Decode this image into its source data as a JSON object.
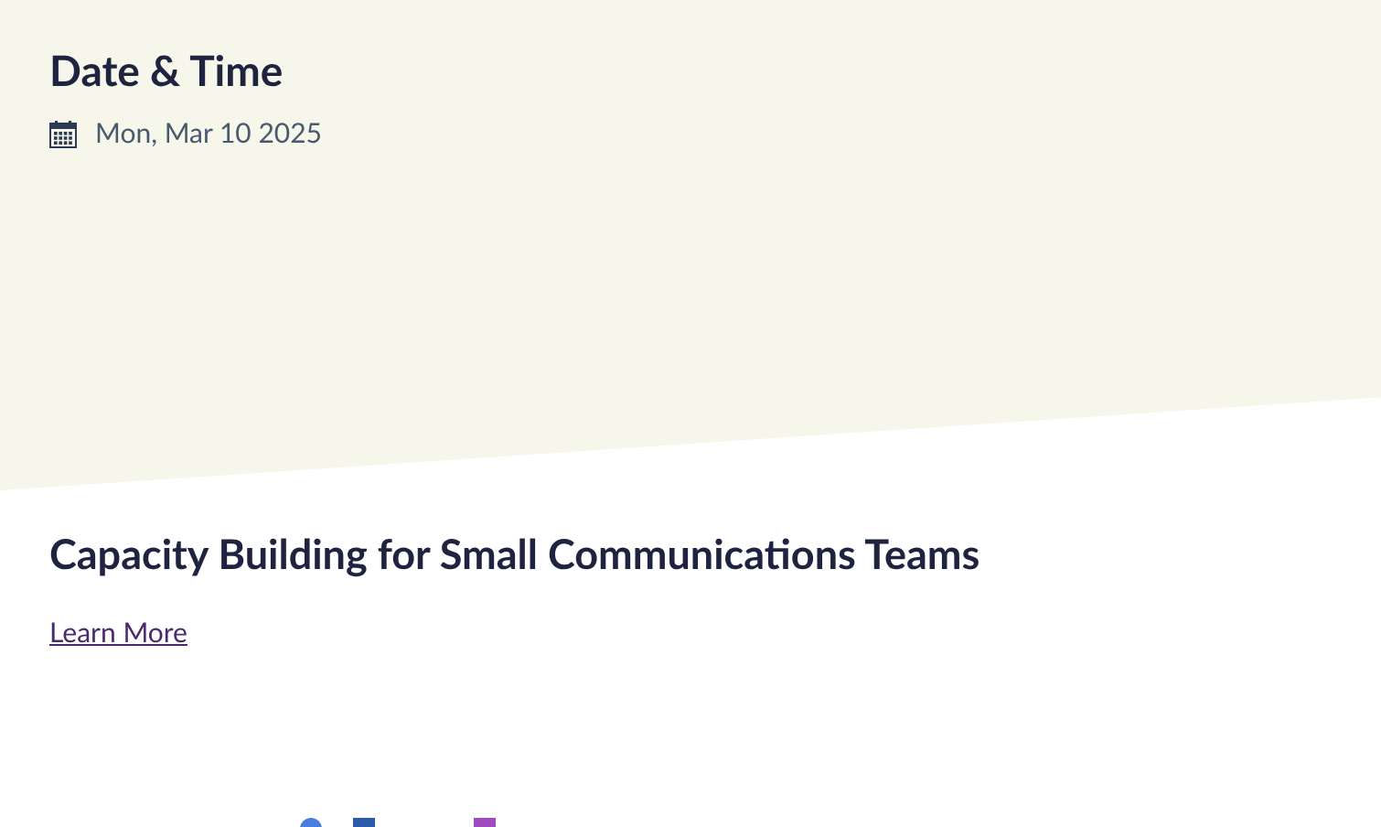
{
  "event": {
    "heading": "Date & Time",
    "date": "Mon, Mar 10 2025"
  },
  "title": "Capacity Building for Small Communications Teams",
  "link": "Learn More"
}
